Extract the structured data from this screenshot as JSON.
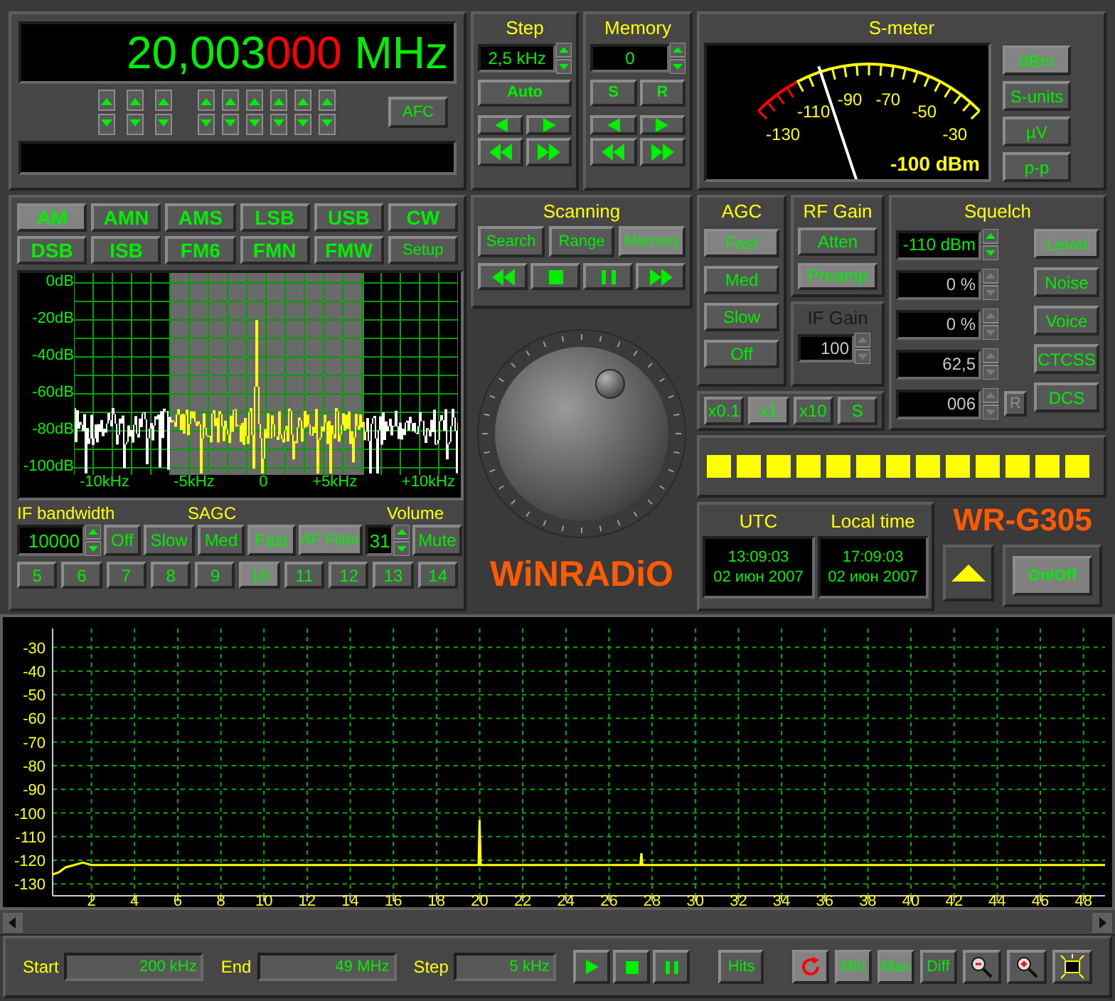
{
  "frequency": {
    "digits": "20,003",
    "fine_digits": "000",
    "unit": "MHz"
  },
  "afc_button": "AFC",
  "step": {
    "title": "Step",
    "value": "2,5 kHz",
    "auto_button": "Auto"
  },
  "memory": {
    "title": "Memory",
    "value": "0",
    "buttons": [
      "S",
      "R"
    ]
  },
  "s_meter": {
    "title": "S-meter",
    "scale": [
      "-130",
      "-110",
      "-90",
      "-70",
      "-50",
      "-30"
    ],
    "level": 0.3,
    "reading": "-100 dBm",
    "units": [
      {
        "label": "dBm",
        "selected": true
      },
      {
        "label": "S-units",
        "selected": false
      },
      {
        "label": "µV",
        "selected": false
      },
      {
        "label": "p-p",
        "selected": false
      }
    ]
  },
  "modes": [
    {
      "label": "AM",
      "selected": true
    },
    {
      "label": "AMN",
      "selected": false
    },
    {
      "label": "AMS",
      "selected": false
    },
    {
      "label": "LSB",
      "selected": false
    },
    {
      "label": "USB",
      "selected": false
    },
    {
      "label": "CW",
      "selected": false
    },
    {
      "label": "DSB",
      "selected": false
    },
    {
      "label": "ISB",
      "selected": false
    },
    {
      "label": "FM6",
      "selected": false
    },
    {
      "label": "FMN",
      "selected": false
    },
    {
      "label": "FMW",
      "selected": false
    }
  ],
  "setup_button": "Setup",
  "if_spectrum": {
    "y_labels": [
      "0dB",
      "-20dB",
      "-40dB",
      "-60dB",
      "-80dB",
      "-100dB"
    ],
    "x_labels": [
      "-10kHz",
      "-5kHz",
      "0",
      "+5kHz",
      "+10kHz"
    ]
  },
  "if_bandwidth": {
    "label": "IF bandwidth",
    "value": "10000"
  },
  "sagc": {
    "label": "SAGC",
    "options": [
      {
        "label": "Off",
        "selected": false
      },
      {
        "label": "Slow",
        "selected": false
      },
      {
        "label": "Med",
        "selected": false
      },
      {
        "label": "Fast",
        "selected": true
      }
    ]
  },
  "af_filter": {
    "label": "AF Filter",
    "selected": true
  },
  "volume": {
    "label": "Volume",
    "value": "31",
    "mute": {
      "label": "Mute",
      "selected": false
    }
  },
  "presets": [
    {
      "label": "5",
      "selected": false
    },
    {
      "label": "6",
      "selected": false
    },
    {
      "label": "7",
      "selected": false
    },
    {
      "label": "8",
      "selected": false
    },
    {
      "label": "9",
      "selected": false
    },
    {
      "label": "10",
      "selected": true
    },
    {
      "label": "11",
      "selected": false
    },
    {
      "label": "12",
      "selected": false
    },
    {
      "label": "13",
      "selected": false
    },
    {
      "label": "14",
      "selected": false
    }
  ],
  "scanning": {
    "title": "Scanning",
    "modes": [
      {
        "label": "Search",
        "selected": false
      },
      {
        "label": "Range",
        "selected": false
      },
      {
        "label": "Memory",
        "selected": true
      }
    ]
  },
  "logo": "WiNRADiO",
  "agc": {
    "title": "AGC",
    "options": [
      {
        "label": "Fast",
        "selected": true
      },
      {
        "label": "Med",
        "selected": false
      },
      {
        "label": "Slow",
        "selected": false
      },
      {
        "label": "Off",
        "selected": false
      }
    ]
  },
  "rf_gain": {
    "title": "RF Gain",
    "options": [
      {
        "label": "Atten",
        "selected": false
      },
      {
        "label": "Preamp",
        "selected": true
      }
    ]
  },
  "if_gain": {
    "title": "IF Gain",
    "value": "100",
    "disabled": true
  },
  "multipliers": [
    {
      "label": "x0.1",
      "selected": false
    },
    {
      "label": "x1",
      "selected": true
    },
    {
      "label": "x10",
      "selected": false
    },
    {
      "label": "S",
      "selected": false
    }
  ],
  "squelch": {
    "title": "Squelch",
    "fields": [
      {
        "value": "-110 dBm",
        "disabled": false
      },
      {
        "value": "0 %",
        "disabled": true
      },
      {
        "value": "0 %",
        "disabled": true
      },
      {
        "value": "62,5",
        "disabled": true
      },
      {
        "value": "006",
        "disabled": true
      }
    ],
    "modes": [
      {
        "label": "Level",
        "selected": true
      },
      {
        "label": "Noise",
        "selected": false
      },
      {
        "label": "Voice",
        "selected": false
      },
      {
        "label": "CTCSS",
        "selected": false
      },
      {
        "label": "DCS",
        "selected": false
      }
    ],
    "reset_button": {
      "label": "R",
      "disabled": true
    }
  },
  "signal_meter": {
    "level": 1
  },
  "clocks": [
    {
      "title": "UTC",
      "time": "13:09:03",
      "date": "02 июн 2007"
    },
    {
      "title": "Local time",
      "time": "17:09:03",
      "date": "02 июн 2007"
    }
  ],
  "model": "WR-G305",
  "power_button": "On/Off",
  "sweep": {
    "chart_data": {
      "type": "line",
      "grid": true,
      "xlim": [
        0.2,
        49
      ],
      "ylim": [
        -135,
        -22
      ],
      "xticks": [
        2,
        4,
        6,
        8,
        10,
        12,
        14,
        16,
        18,
        20,
        22,
        24,
        26,
        28,
        30,
        32,
        34,
        36,
        38,
        40,
        42,
        44,
        46,
        48
      ],
      "yticks": [
        -30,
        -40,
        -50,
        -60,
        -70,
        -80,
        -90,
        -100,
        -110,
        -120,
        -130
      ],
      "x": [
        0.2,
        0.5,
        0.8,
        1.2,
        1.6,
        2,
        18.5,
        19.95,
        20,
        20.05,
        27.45,
        27.5,
        27.55,
        49
      ],
      "series": [
        {
          "color": "#ffff00",
          "values": [
            -126,
            -125,
            -123,
            -122,
            -121,
            -122,
            -122,
            -122,
            -103,
            -122,
            -122,
            -117,
            -122,
            -122
          ]
        }
      ]
    }
  },
  "sweep_controls": {
    "start": {
      "label": "Start",
      "value": "200 kHz"
    },
    "end": {
      "label": "End",
      "value": "49 MHz"
    },
    "step": {
      "label": "Step",
      "value": "5 kHz"
    },
    "hits_button": "Hits",
    "refresh": {
      "selected": true
    },
    "toggles": [
      {
        "label": "Min",
        "selected": true
      },
      {
        "label": "Max",
        "selected": true
      },
      {
        "label": "Diff",
        "selected": false
      }
    ]
  }
}
